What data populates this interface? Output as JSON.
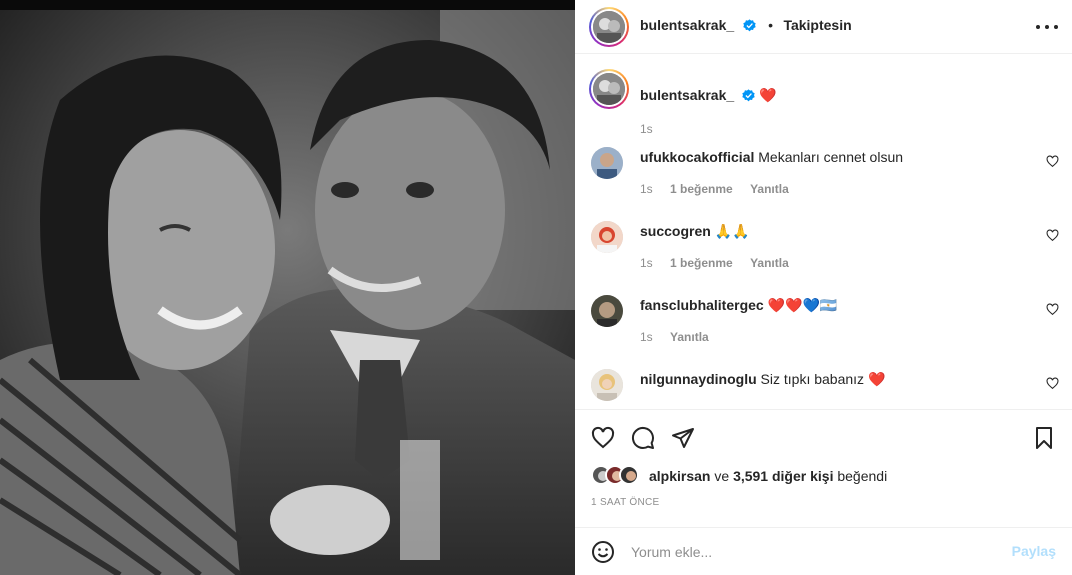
{
  "post": {
    "author": "bulentsakrak_",
    "follow_status": "Takiptesin",
    "separator": "•",
    "photo_description": "black and white photograph of a smiling couple"
  },
  "caption": {
    "username": "bulentsakrak_",
    "emoji": "❤️",
    "time": "1s"
  },
  "comments": [
    {
      "username": "ufukkocakofficial",
      "text": "Mekanları cennet olsun",
      "time": "1s",
      "likes": "1 beğenme",
      "reply": "Yanıtla"
    },
    {
      "username": "succogren",
      "text": "🙏🙏",
      "time": "1s",
      "likes": "1 beğenme",
      "reply": "Yanıtla"
    },
    {
      "username": "fansclubhalitergec",
      "text": "❤️❤️💙🇦🇷",
      "time": "1s",
      "reply": "Yanıtla"
    },
    {
      "username": "nilgunnaydinoglu",
      "text": "Siz tıpkı babanız ❤️"
    }
  ],
  "likes": {
    "first_liker": "alpkirsan",
    "connector": "ve",
    "others": "3,591 diğer kişi",
    "suffix": "beğendi"
  },
  "time_ago": "1 SAAT ÖNCE",
  "comment_box": {
    "placeholder": "Yorum ekle...",
    "post_label": "Paylaş"
  },
  "colors": {
    "accent_blue": "#0095f6",
    "disabled_blue": "#b2dffc",
    "muted_text": "#8e8e8e",
    "heart_red": "#ed4956"
  },
  "icons": [
    "heart-icon",
    "comment-icon",
    "share-icon",
    "bookmark-icon",
    "smiley-icon",
    "more-options-icon",
    "verified-icon"
  ]
}
